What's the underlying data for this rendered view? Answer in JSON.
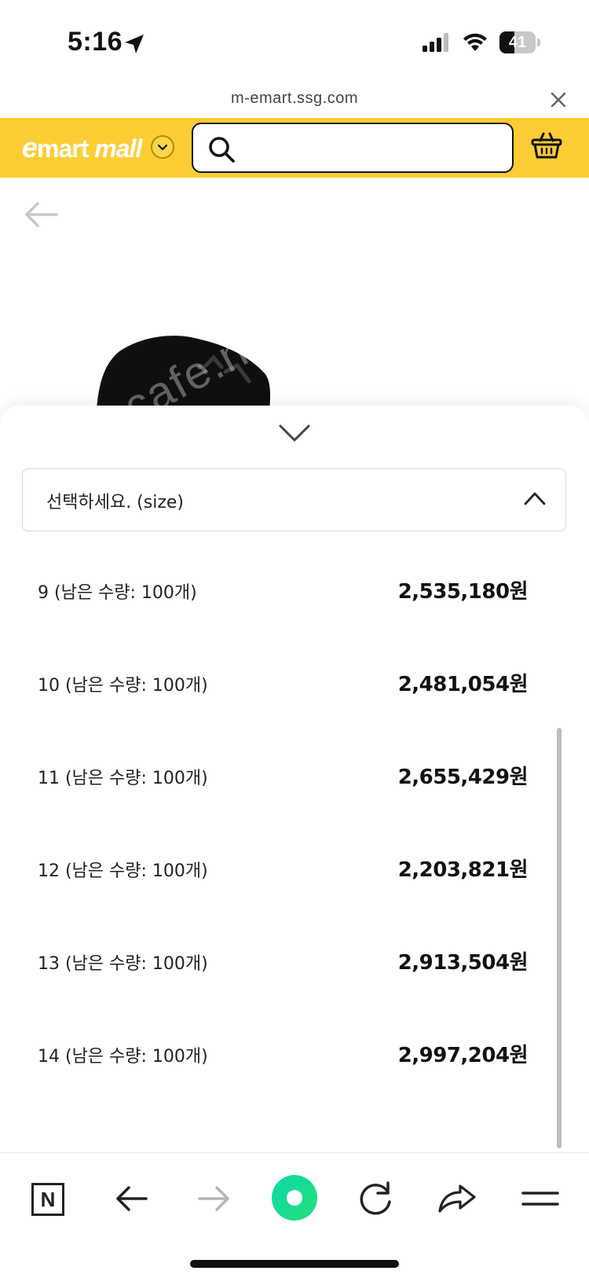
{
  "status_bar": {
    "time": "5:16",
    "battery_level": "41",
    "battery_fraction": 0.41
  },
  "url_bar": {
    "url": "m-emart.ssg.com"
  },
  "header": {
    "logo_e": "e",
    "logo_mart": "mart",
    "logo_mall": "mall",
    "search_placeholder": "",
    "brand_color": "#fccd34"
  },
  "page": {
    "watermark": "cafe.na"
  },
  "sheet": {
    "select_label": "선택하세요. (size)",
    "options": [
      {
        "label": "9 (남은 수량: 100개)",
        "price": "2,535,180원"
      },
      {
        "label": "10 (남은 수량: 100개)",
        "price": "2,481,054원"
      },
      {
        "label": "11 (남은 수량: 100개)",
        "price": "2,655,429원"
      },
      {
        "label": "12 (남은 수량: 100개)",
        "price": "2,203,821원"
      },
      {
        "label": "13 (남은 수량: 100개)",
        "price": "2,913,504원"
      },
      {
        "label": "14 (남은 수량: 100개)",
        "price": "2,997,204원"
      }
    ]
  },
  "toolbar": {
    "n_label": "N",
    "items": [
      "naver-n-icon",
      "back-arrow-icon",
      "forward-arrow-icon",
      "home-green-icon",
      "reload-icon",
      "share-icon",
      "menu-icon"
    ],
    "home_color": "#0bd9a7"
  }
}
